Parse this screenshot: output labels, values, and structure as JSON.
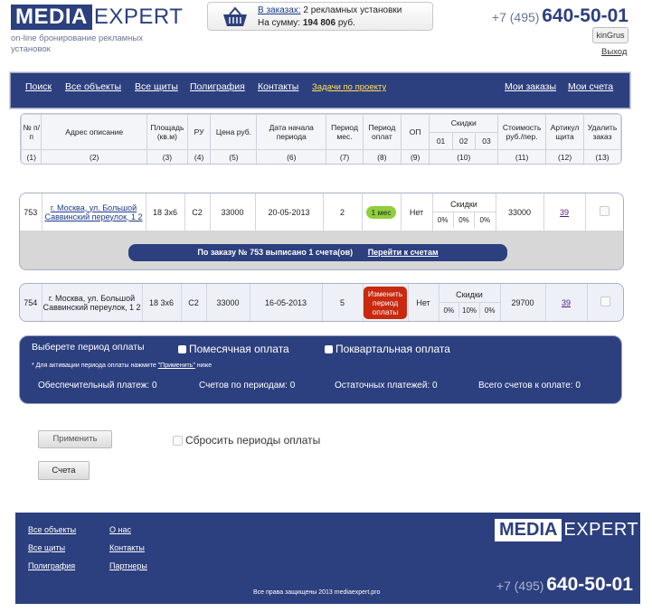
{
  "header": {
    "logo_left": "MEDIA",
    "logo_right": "EXPERT",
    "tagline_1": "on-line бронирование рекламных",
    "tagline_2": "установок",
    "cart_link": "В заказах:",
    "cart_text": "2 рекламных установки",
    "sum_label": "На сумму:",
    "sum_value": "194 806",
    "sum_unit": "руб.",
    "phone_code": "+7 (495)",
    "phone_number": "640-50-01",
    "user": "kinGrus",
    "logout": "Выход"
  },
  "nav": {
    "items": [
      "Поиск",
      "Все объекты",
      "Все щиты",
      "Полиграфия",
      "Контакты",
      "Задачи по проекту"
    ],
    "right": [
      "Мои заказы",
      "Мои счета"
    ]
  },
  "table_head": {
    "cols": [
      {
        "label": "№ п/п",
        "num": "(1)"
      },
      {
        "label": "Адрес описание",
        "num": "(2)"
      },
      {
        "label": "Площадь (кв.м)",
        "num": "(3)"
      },
      {
        "label": "РУ",
        "num": "(4)"
      },
      {
        "label": "Цена руб.",
        "num": "(5)"
      },
      {
        "label": "Дата начала периода",
        "num": "(6)"
      },
      {
        "label": "Период мес.",
        "num": "(7)"
      },
      {
        "label": "Период оплат",
        "num": "(8)"
      },
      {
        "label": "ОП",
        "num": "(9)"
      },
      {
        "label": "Скидки",
        "num": "(10)"
      },
      {
        "label": "Стоимость руб./пер.",
        "num": "(11)"
      },
      {
        "label": "Артикул щита",
        "num": "(12)"
      },
      {
        "label": "Удалить заказ",
        "num": "(13)"
      }
    ],
    "discount_sub": [
      "01",
      "02",
      "03"
    ]
  },
  "orders": [
    {
      "num": "753",
      "address": "г. Москва, ул. Большой Саввинский переулок, 1 2",
      "area": "18 3х6",
      "ru": "С2",
      "price": "33000",
      "date": "20-05-2013",
      "months": "2",
      "period": "1 мес",
      "op": "Нет",
      "discount_title": "Скидки",
      "discounts": [
        "0%",
        "0%",
        "0%"
      ],
      "cost": "33000",
      "article": "39",
      "invoice_text": "По заказу № 753 выписано 1 счета(ов)",
      "invoice_link": "Перейти к счетам"
    },
    {
      "num": "754",
      "address": "г. Москва, ул. Большой Саввинский переулок, 1 2",
      "area": "18 3х6",
      "ru": "С2",
      "price": "33000",
      "date": "16-05-2013",
      "months": "5",
      "period_button": "Изменить период оплаты",
      "op": "Нет",
      "discount_title": "Скидки",
      "discounts": [
        "0%",
        "10%",
        "0%"
      ],
      "cost": "29700",
      "article": "39"
    }
  ],
  "period_box": {
    "title": "Выберете период оплаты",
    "monthly": "Помесячная оплата",
    "quarterly": "Поквартальная оплата",
    "note_prefix": "* Для активации периода оплаты нажмите",
    "note_link": "\"Применить\"",
    "note_suffix": "ниже",
    "stats": [
      {
        "label": "Обеспечительный платеж:",
        "value": "0"
      },
      {
        "label": "Счетов по периодам:",
        "value": "0"
      },
      {
        "label": "Остаточных платежей:",
        "value": "0"
      },
      {
        "label": "Всего счетов к оплате:",
        "value": "0"
      }
    ]
  },
  "actions": {
    "apply": "Применить",
    "reset": "Сбросить периоды оплаты",
    "invoices": "Счета"
  },
  "footer": {
    "col1": [
      "Все объекты",
      "Все щиты",
      "Полиграфия"
    ],
    "col2": [
      "О нас",
      "Контакты",
      "Партнеры"
    ],
    "copyright": "Все права защищены 2013 mediaexpert.pro",
    "logo_left": "MEDIA",
    "logo_right": "EXPERT",
    "phone_code": "+7 (495)",
    "phone_number": "640-50-01"
  },
  "colors": {
    "brand": "#2c3f7e",
    "accent_green": "#8fce3c",
    "accent_red": "#c8290f",
    "nav_highlight": "#ffe15a"
  }
}
